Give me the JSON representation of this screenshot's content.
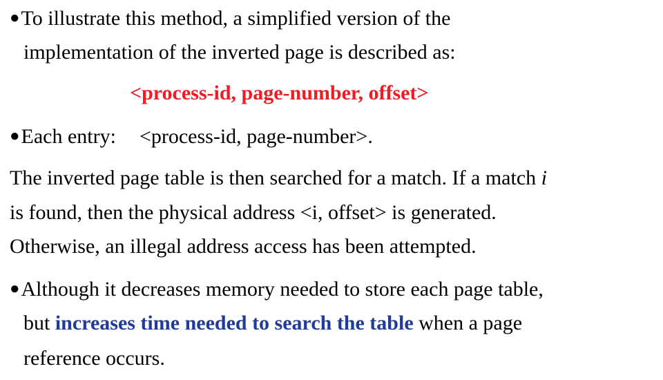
{
  "bullet_symbol": "●",
  "para1": {
    "line1": "To illustrate this method, a simplified version of the",
    "line2": "implementation of the inverted page is described as:"
  },
  "address_format": "<process-id, page-number, offset>",
  "para2": {
    "prefix": "Each entry:",
    "value": "<process-id, page-number>."
  },
  "para3": {
    "line1_a": "The inverted page table is then searched for a match. If a match ",
    "line1_var": "i",
    "line2": "is found, then the physical address <i, offset> is generated.",
    "line3": "Otherwise, an illegal address access has been attempted."
  },
  "para4": {
    "line1": "Although it decreases memory needed to store each page table,",
    "line2_a": "but ",
    "line2_highlight": "increases time needed to search the table",
    "line2_b": " when a page",
    "line3": "reference occurs."
  },
  "colors": {
    "highlight_red": "#ee1c24",
    "highlight_blue": "#1f3c9a",
    "text": "#000000"
  }
}
